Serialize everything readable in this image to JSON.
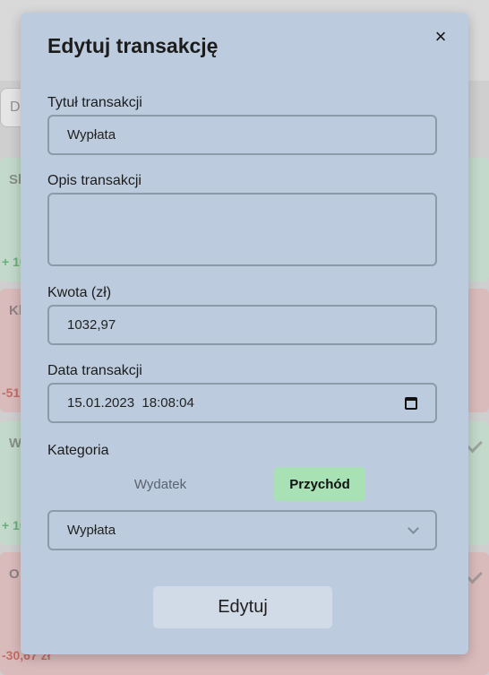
{
  "background": {
    "search_placeholder": "D",
    "cards": [
      {
        "title": "Sk",
        "amount": "+ 10",
        "kind": "income"
      },
      {
        "title": "Kl",
        "amount": "-51",
        "kind": "expense"
      },
      {
        "title": "W",
        "amount": "+ 10",
        "kind": "income"
      },
      {
        "title": "O",
        "amount": "-30,67 zł",
        "kind": "expense"
      }
    ]
  },
  "modal": {
    "title": "Edytuj transakcję",
    "close_icon": "×",
    "title_field": {
      "label": "Tytuł transakcji",
      "value": "Wypłata"
    },
    "description_field": {
      "label": "Opis transakcji",
      "value": ""
    },
    "amount_field": {
      "label": "Kwota (zł)",
      "value": "1032,97"
    },
    "date_field": {
      "label": "Data transakcji",
      "value": "15.01.2023  18:08:04"
    },
    "category": {
      "label": "Kategoria",
      "expense_label": "Wydatek",
      "income_label": "Przychód",
      "selected_type": "Przychód",
      "selected_value": "Wypłata"
    },
    "submit_label": "Edytuj"
  }
}
